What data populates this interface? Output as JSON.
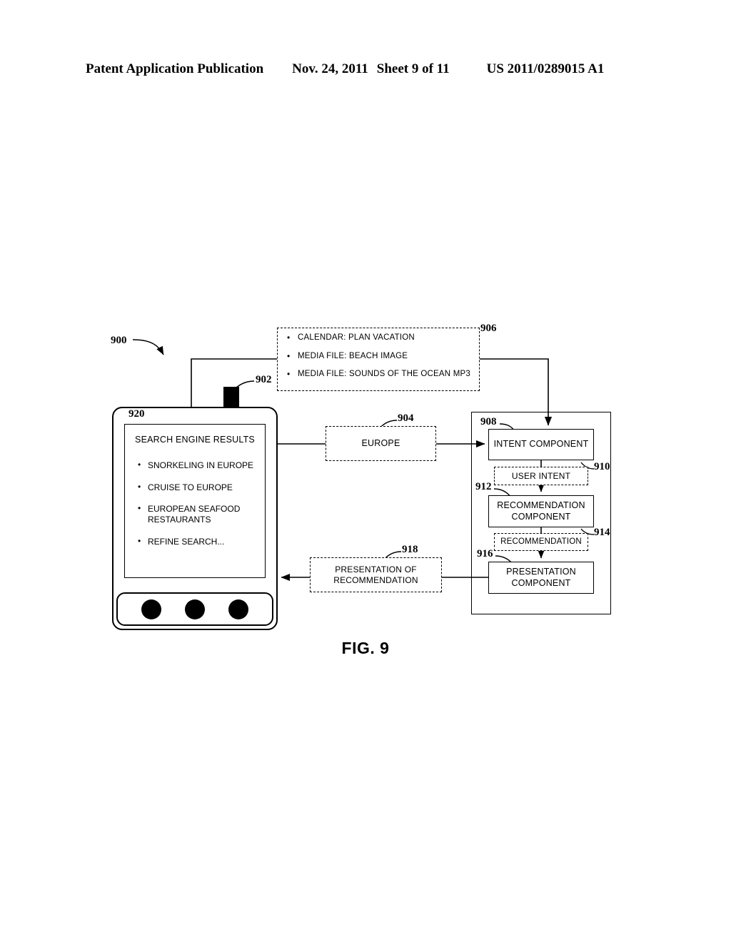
{
  "header": {
    "publication": "Patent Application Publication",
    "date": "Nov. 24, 2011",
    "sheet": "Sheet 9 of 11",
    "number": "US 2011/0289015 A1"
  },
  "figure": {
    "caption": "FIG. 9",
    "overall_ref": "900"
  },
  "context_box": {
    "ref": "906",
    "items": [
      "CALENDAR: PLAN VACATION",
      "MEDIA FILE: BEACH IMAGE",
      "MEDIA FILE: SOUNDS OF THE OCEAN MP3"
    ]
  },
  "device": {
    "ref": "902",
    "screen_ref": "920",
    "screen": {
      "title": "SEARCH ENGINE RESULTS",
      "results": [
        "SNORKELING IN EUROPE",
        "CRUISE TO EUROPE",
        "EUROPEAN SEAFOOD RESTAURANTS",
        "REFINE SEARCH..."
      ]
    },
    "buttons": [
      "button-left",
      "button-center",
      "button-right"
    ]
  },
  "query_box": {
    "ref": "904",
    "label": "EUROPE"
  },
  "presentation_box": {
    "ref": "918",
    "line1": "PRESENTATION OF",
    "line2": "RECOMMENDATION"
  },
  "system": {
    "intent_component": {
      "ref": "908",
      "label": "INTENT COMPONENT"
    },
    "user_intent": {
      "ref": "910",
      "label": "USER INTENT"
    },
    "recommendation_component": {
      "ref": "912",
      "line1": "RECOMMENDATION",
      "line2": "COMPONENT"
    },
    "recommendation": {
      "ref": "914",
      "label": "RECOMMENDATION"
    },
    "presentation_component": {
      "ref": "916",
      "line1": "PRESENTATION",
      "line2": "COMPONENT"
    }
  },
  "colors": {
    "ink": "#000000",
    "paper": "#ffffff"
  }
}
